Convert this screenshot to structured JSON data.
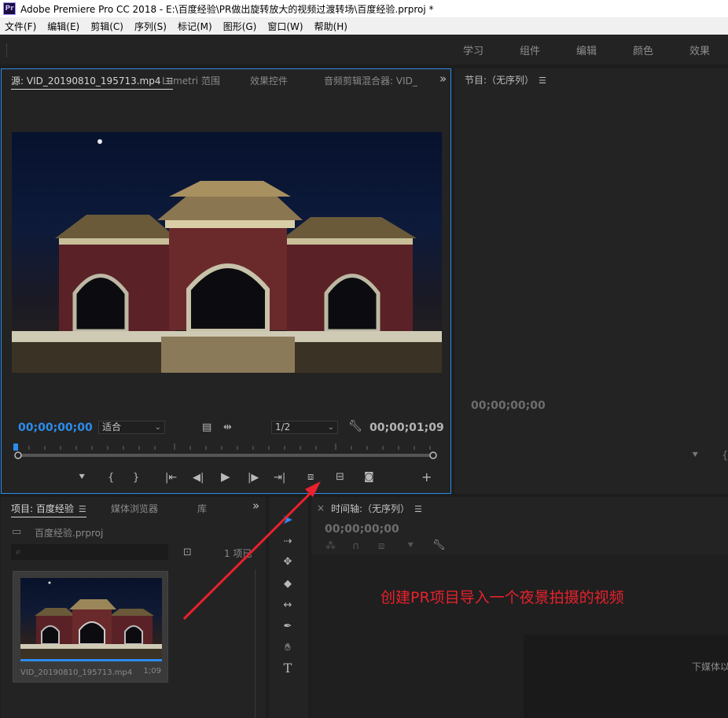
{
  "window": {
    "app_badge": "Pr",
    "title": "Adobe Premiere Pro CC 2018 - E:\\百度经验\\PR做出旋转放大的视频过渡转场\\百度经验.prproj *"
  },
  "menu": [
    "文件(F)",
    "编辑(E)",
    "剪辑(C)",
    "序列(S)",
    "标记(M)",
    "图形(G)",
    "窗口(W)",
    "帮助(H)"
  ],
  "workspaces": [
    "学习",
    "组件",
    "编辑",
    "颜色",
    "效果"
  ],
  "source_panel": {
    "tabs": [
      "源: VID_20190810_195713.mp4",
      "Lumetri 范围",
      "效果控件",
      "音频剪辑混合器: VID_"
    ],
    "overflow": "»",
    "timecode_in": "00;00;00;00",
    "fit_label": "适合",
    "resolution": "1/2",
    "timecode_duration": "00;00;01;09"
  },
  "program_panel": {
    "title": "节目:（无序列）",
    "timecode": "00;00;00;00"
  },
  "project_panel": {
    "tabs": [
      "项目: 百度经验",
      "媒体浏览器",
      "库"
    ],
    "overflow": "»",
    "project_file": "百度经验.prproj",
    "item_count": "1 项已",
    "clip_name": "VID_20190810_195713.mp4",
    "clip_duration": "1;09"
  },
  "timeline_panel": {
    "close": "×",
    "title": "时间轴:（无序列）",
    "timecode": "00;00;00;00",
    "drop_hint": "下媒体以"
  },
  "annotation": {
    "text": "创建PR项目导入一个夜景拍摄的视频",
    "color": "#e8212c"
  }
}
